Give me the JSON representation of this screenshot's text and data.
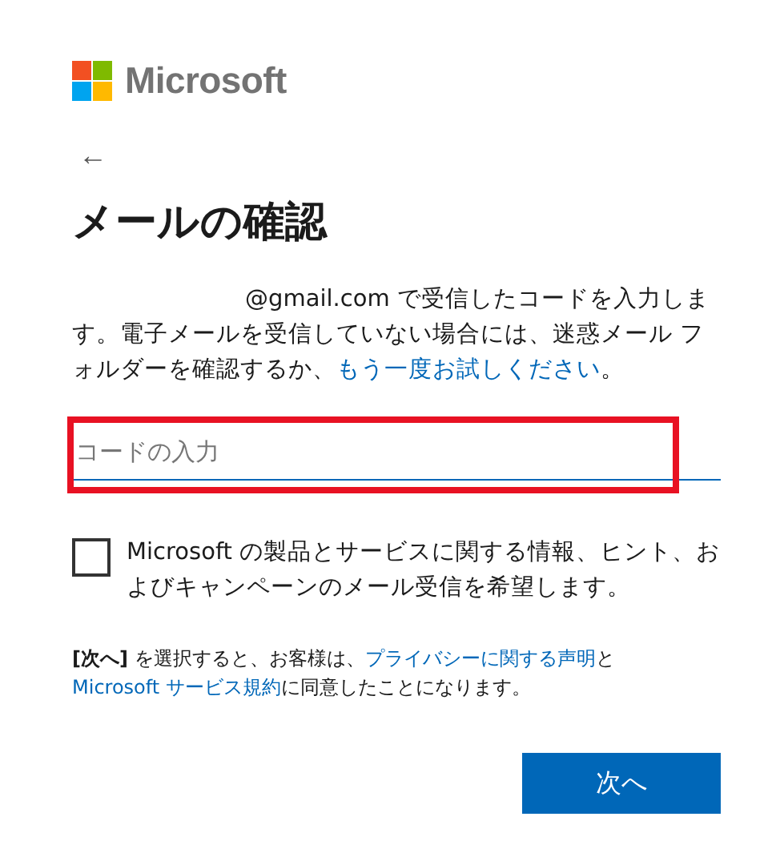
{
  "logo": {
    "text": "Microsoft"
  },
  "back": {
    "label": "←"
  },
  "title": "メールの確認",
  "message": [
    {
      "kind": "text",
      "text": "@gmail.com で受信したコードを入力します。電子メールを受信していない場合には、迷惑メール フォルダーを確認するか、"
    },
    {
      "kind": "link",
      "text": "もう一度お試しください"
    },
    {
      "kind": "text",
      "text": "。"
    }
  ],
  "code_field": {
    "placeholder": "コードの入力",
    "highlighted": true
  },
  "opt_in": {
    "label": "Microsoft の製品とサービスに関する情報、ヒント、およびキャンペーンのメール受信を希望します。",
    "checked": false
  },
  "legal": [
    {
      "kind": "text",
      "text": "**[次へ]** を選択すると、お客様は、"
    },
    {
      "kind": "link",
      "text": "プライバシーに関する声明"
    },
    {
      "kind": "text",
      "text": "と "
    },
    {
      "kind": "link",
      "text": "Microsoft サービス規約"
    },
    {
      "kind": "text",
      "text": "に同意したことになります。"
    }
  ],
  "next_button": {
    "label": "次へ"
  }
}
